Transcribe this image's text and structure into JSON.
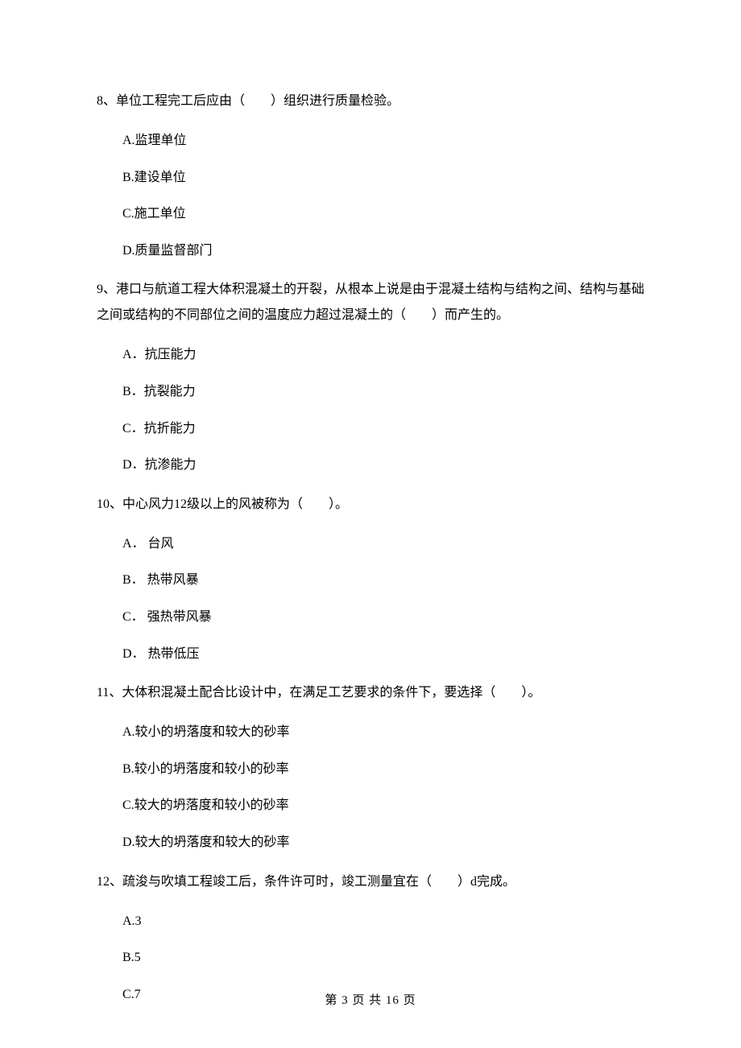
{
  "questions": [
    {
      "text": "8、单位工程完工后应由（　　）组织进行质量检验。",
      "options": [
        "A.监理单位",
        "B.建设单位",
        "C.施工单位",
        "D.质量监督部门"
      ]
    },
    {
      "text": "9、港口与航道工程大体积混凝土的开裂，从根本上说是由于混凝土结构与结构之间、结构与基础之间或结构的不同部位之间的温度应力超过混凝土的（　　）而产生的。",
      "options": [
        "A．抗压能力",
        "B．抗裂能力",
        "C．抗折能力",
        "D．抗渗能力"
      ]
    },
    {
      "text": "10、中心风力12级以上的风被称为（　　）。",
      "options": [
        "A． 台风",
        "B． 热带风暴",
        "C． 强热带风暴",
        "D． 热带低压"
      ]
    },
    {
      "text": "11、大体积混凝土配合比设计中，在满足工艺要求的条件下，要选择（　　）。",
      "options": [
        "A.较小的坍落度和较大的砂率",
        "B.较小的坍落度和较小的砂率",
        "C.较大的坍落度和较小的砂率",
        "D.较大的坍落度和较大的砂率"
      ]
    },
    {
      "text": "12、疏浚与吹填工程竣工后，条件许可时，竣工测量宜在（　　）d完成。",
      "options": [
        "A.3",
        "B.5",
        "C.7"
      ]
    }
  ],
  "footer": "第 3 页 共 16 页"
}
